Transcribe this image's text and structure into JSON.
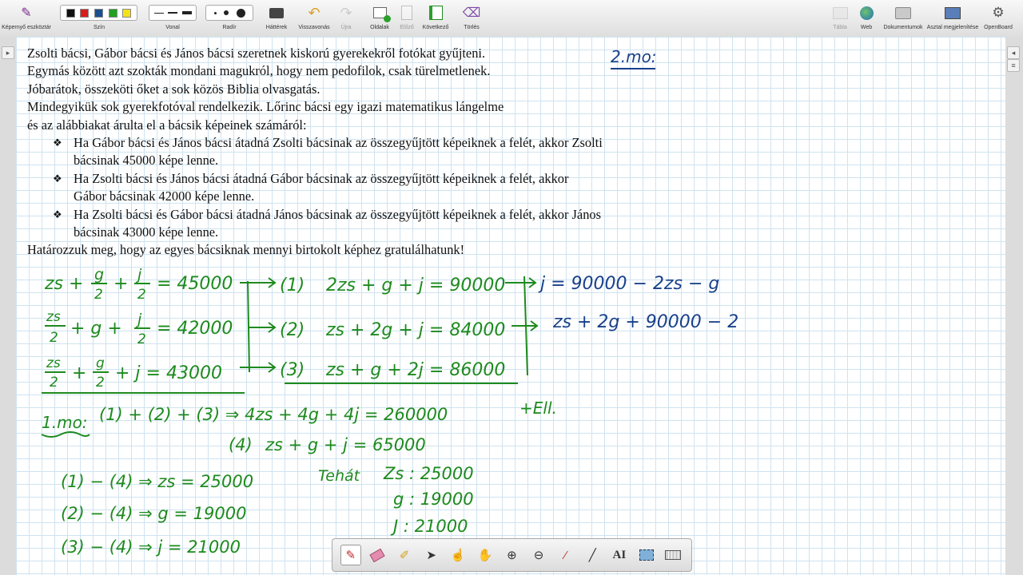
{
  "toolbar": {
    "screen_tools_label": "Képernyő eszköztár",
    "color_label": "Szín",
    "line_label": "Vonal",
    "eraser_label": "Radír",
    "background_label": "Háttérek",
    "undo_label": "Visszavonás",
    "redo_label": "Újra",
    "pages_label": "Oldalak",
    "prev_label": "Előző",
    "next_label": "Következő",
    "clear_label": "Törlés",
    "board_label": "Tábla",
    "web_label": "Web",
    "documents_label": "Dokumentumok",
    "desktop_label": "Asztal megjelenítése",
    "openboard_label": "OpenBoard",
    "colors": [
      "#111111",
      "#d81c1c",
      "#1a4f8f",
      "#21a121",
      "#f2e21a"
    ]
  },
  "problem": {
    "intro_1": "Zsolti bácsi, Gábor bácsi és János bácsi szeretnek kiskorú gyerekekről fotókat gyűjteni.",
    "intro_2": "Egymás között azt szokták mondani magukról, hogy nem pedofilok, csak türelmetlenek.",
    "intro_3": "Jóbarátok, összeköti őket a sok közös Biblia olvasgatás.",
    "intro_4": "Mindegyikük sok gyerekfotóval rendelkezik. Lőrinc bácsi egy igazi matematikus lángelme",
    "intro_5": "és az alábbiakat árulta el a bácsik képeinek számáról:",
    "bullet_1": "Ha Gábor bácsi és János bácsi átadná Zsolti bácsinak az összegyűjtött képeiknek a felét, akkor Zsolti bácsinak 45000 képe lenne.",
    "bullet_2": "Ha Zsolti bácsi és János bácsi átadná Gábor bácsinak az összegyűjtött képeiknek a felét, akkor Gábor bácsinak 42000 képe lenne.",
    "bullet_3": "Ha Zsolti bácsi és Gábor bácsi átadná János bácsinak az összegyűjtött képeiknek a felét, akkor János bácsinak 43000 képe lenne.",
    "question": "Határozzuk meg, hogy az egyes bácsiknak mennyi birtokolt képhez gratulálhatunk!"
  },
  "handwriting": {
    "heading_2": "2.mo:",
    "eq_a_num": "g",
    "eq_a_num2": "j",
    "eq_a_lhs": "zs +",
    "eq_a_rhs": "= 45000",
    "eq_b_num": "zs",
    "eq_b_num2": "j",
    "eq_b_mid": "+ g +",
    "eq_b_rhs": "= 42000",
    "eq_c_num": "zs",
    "eq_c_num2": "g",
    "eq_c_end": "+ j = 43000",
    "plus": "+",
    "half_den": "2",
    "label_1": "(1)",
    "label_2": "(2)",
    "label_3": "(3)",
    "label_4": "(4)",
    "sys_1": "2zs + g + j = 90000",
    "sys_2": "zs + 2g + j = 84000",
    "sys_3": "zs + g + 2j = 86000",
    "sub_1": "j = 90000 − 2zs − g",
    "sub_2": "zs + 2g + 90000 − 2",
    "sol_label": "1.mo:",
    "sol_sum": "(1) + (2) + (3) ⇒ 4zs + 4g + 4j = 260000",
    "check_note": "+Ell.",
    "sol_4": "zs + g + j = 65000",
    "diff_1": "(1) − (4) ⇒ zs = 25000",
    "diff_2": "(2) − (4) ⇒ g = 19000",
    "diff_3": "(3) − (4) ⇒ j = 21000",
    "tehat": "Tehát",
    "res_zs": "Zs : 25000",
    "res_g": "g : 19000",
    "res_j": "J : 21000"
  },
  "colors": {
    "ink_green": "#1e8a1e",
    "ink_blue": "#18408a",
    "grid": "#cfe3f0"
  }
}
